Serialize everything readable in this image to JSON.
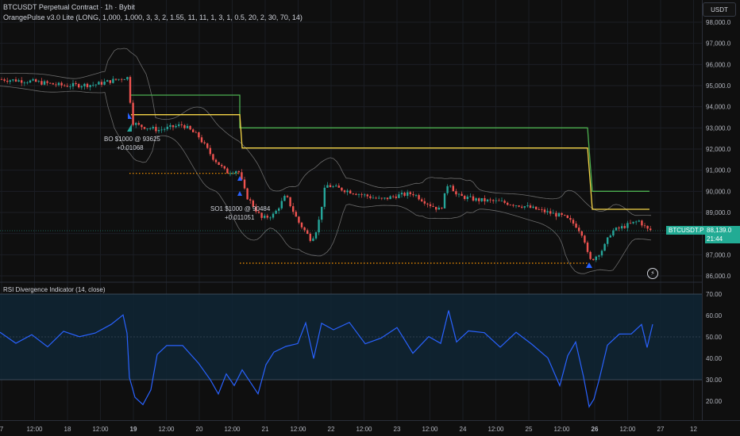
{
  "header": {
    "title": "BTCUSDT Perpetual Contract · 1h · Bybit",
    "indicator": "OrangePulse v3.0 Lite (LONG, 1,000, 1,000, 3, 3, 2, 1.55, 11, 11, 1, 3, 1, 0.5, 20, 2, 30, 70, 14)",
    "currency": "USDT"
  },
  "price_axis": {
    "ticks": [
      "98,000.0",
      "97,000.0",
      "96,000.0",
      "95,000.0",
      "94,000.0",
      "93,000.0",
      "92,000.0",
      "91,000.0",
      "90,000.0",
      "89,000.0",
      "88,000.0",
      "87,000.0",
      "86,000.0"
    ],
    "tick_values": [
      98000,
      97000,
      96000,
      95000,
      94000,
      93000,
      92000,
      91000,
      90000,
      89000,
      88000,
      87000,
      86000
    ]
  },
  "last_price": {
    "symbol": "BTCUSDT.P",
    "price": "88,139.0",
    "countdown": "21:44"
  },
  "time_axis": {
    "labels": [
      "7",
      "12:00",
      "18",
      "12:00",
      "19",
      "12:00",
      "20",
      "12:00",
      "21",
      "12:00",
      "22",
      "12:00",
      "23",
      "12:00",
      "24",
      "12:00",
      "25",
      "12:00",
      "26",
      "12:00",
      "27",
      "12"
    ],
    "bold": [
      "19",
      "26"
    ]
  },
  "annotations": [
    {
      "text": "BO $1000 @ 93625",
      "sub": "+0.01068"
    },
    {
      "text": "SO1 $1000 @ 90484",
      "sub": "+0.011051"
    }
  ],
  "rsi": {
    "title": "RSI Divergence Indicator (14, close)",
    "ticks": [
      "70.00",
      "60.00",
      "50.00",
      "40.00",
      "30.00",
      "20.00"
    ],
    "tick_values": [
      70,
      60,
      50,
      40,
      30,
      20
    ]
  },
  "colors": {
    "up": "#26a69a",
    "down": "#ef5350",
    "green_line": "#4caf50",
    "yellow_line": "#f5d547",
    "rsi_line": "#2962ff",
    "band": "#6b6b6b",
    "dotted": "#ff9800",
    "tag": "#22ab94"
  },
  "icons": {
    "flash": "lightning-icon"
  }
}
